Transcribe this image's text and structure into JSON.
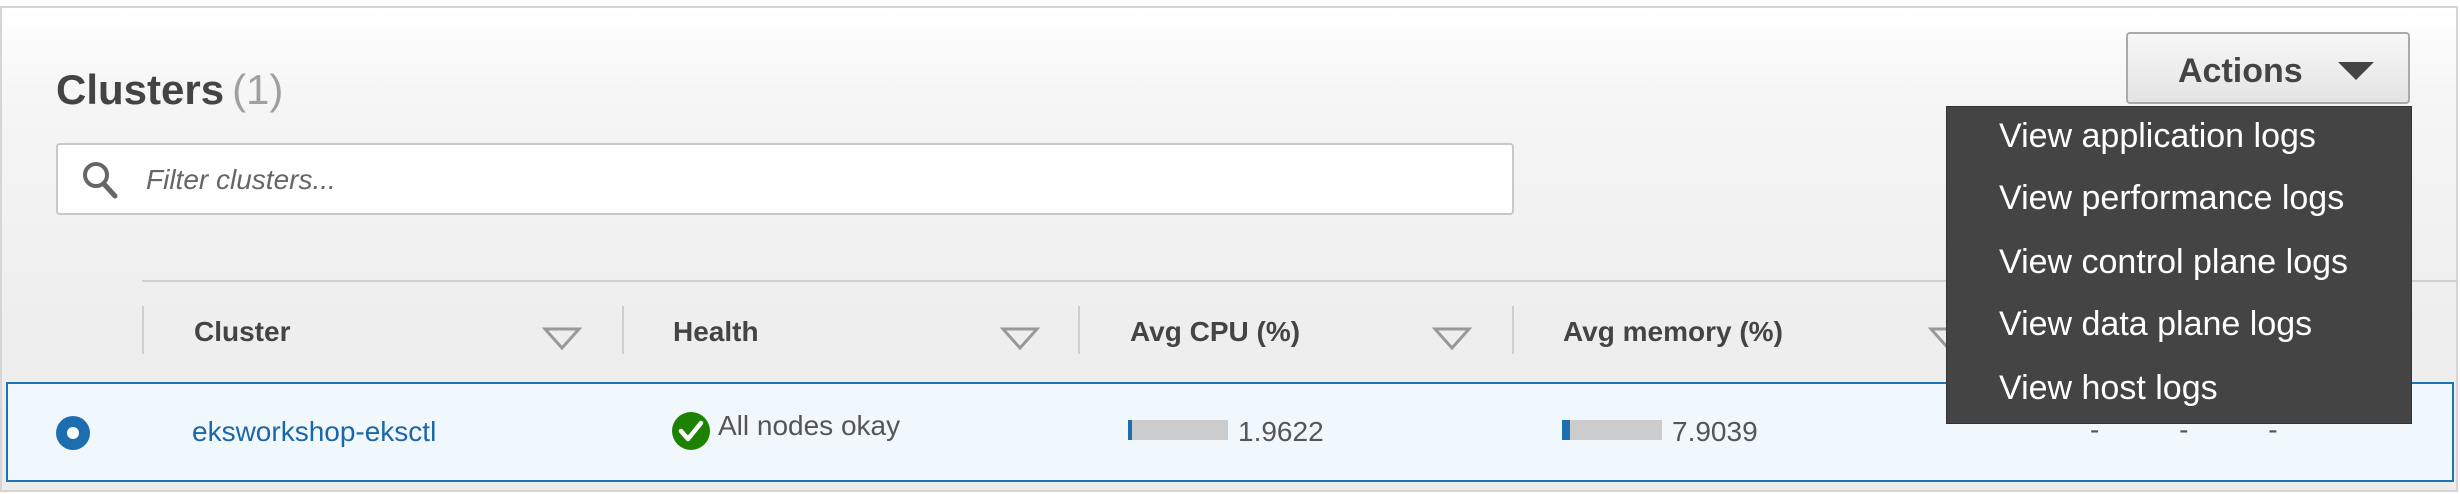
{
  "header": {
    "title": "Clusters",
    "count": "(1)",
    "actions_label": "Actions"
  },
  "search": {
    "placeholder": "Filter clusters..."
  },
  "table": {
    "columns": [
      "Cluster",
      "Health",
      "Avg CPU (%)",
      "Avg memory (%)"
    ],
    "rows": [
      {
        "cluster": "eksworkshop-eksctl",
        "health": "All nodes okay",
        "cpu": "1.9622",
        "memory": "7.9039",
        "extra": "- - -",
        "selected": true
      }
    ]
  },
  "actions_menu": {
    "items": [
      "View application logs",
      "View performance logs",
      "View control plane logs",
      "View data plane logs",
      "View host logs"
    ]
  },
  "colors": {
    "accent": "#1d73b3",
    "selected_row_bg": "#f0f8fd",
    "health_ok": "#1d8102",
    "menu_bg": "#444444"
  },
  "icons": {
    "search": "search-icon",
    "sort": "sort-down-icon",
    "health": "check-circle-icon",
    "dropdown": "caret-down-icon"
  }
}
